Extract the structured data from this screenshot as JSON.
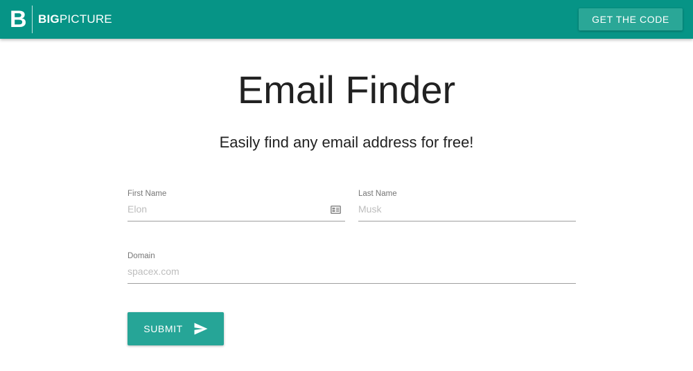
{
  "header": {
    "logo_mark": "B",
    "logo_bold": "BIG",
    "logo_light": "PICTURE",
    "code_button_label": "GET THE CODE",
    "bar_color": "#069486"
  },
  "main": {
    "title": "Email Finder",
    "subtitle": "Easily find any email address for free!"
  },
  "form": {
    "first_name": {
      "label": "First Name",
      "placeholder": "Elon",
      "value": "",
      "icon": "contact-card-icon"
    },
    "last_name": {
      "label": "Last Name",
      "placeholder": "Musk",
      "value": ""
    },
    "domain": {
      "label": "Domain",
      "placeholder": "spacex.com",
      "value": ""
    },
    "submit": {
      "label": "SUBMIT",
      "icon": "send-icon",
      "color": "#26a597"
    }
  }
}
